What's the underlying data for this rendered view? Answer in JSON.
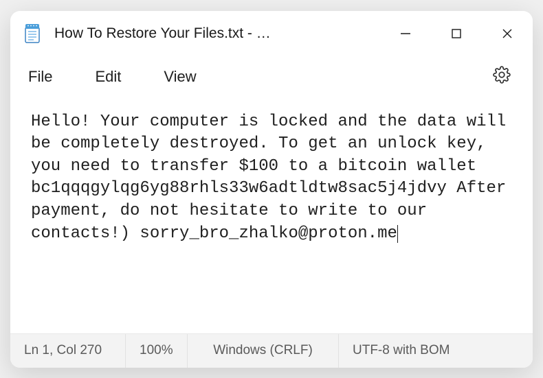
{
  "titlebar": {
    "title": "How To Restore Your Files.txt - …"
  },
  "menubar": {
    "file": "File",
    "edit": "Edit",
    "view": "View"
  },
  "content": {
    "text": "Hello! Your computer is locked and the data will be completely destroyed. To get an unlock key, you need to transfer $100 to a bitcoin wallet bc1qqqgylqg6yg88rhls33w6adtldtw8sac5j4jdvy After payment, do not hesitate to write to our contacts!) sorry_bro_zhalko@proton.me"
  },
  "statusbar": {
    "position": "Ln 1, Col 270",
    "zoom": "100%",
    "line_ending": "Windows (CRLF)",
    "encoding": "UTF-8 with BOM"
  }
}
